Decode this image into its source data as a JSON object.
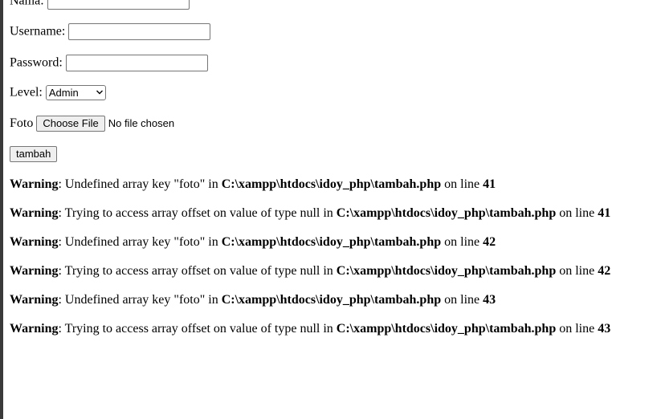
{
  "form": {
    "nama_label": "Nama:",
    "username_label": "Username:",
    "password_label": "Password:",
    "level_label": "Level:",
    "level_selected": "Admin",
    "foto_label": "Foto",
    "choose_file_label": "Choose File",
    "no_file_text": "No file chosen",
    "submit_label": "tambah"
  },
  "warnings": [
    {
      "label": "Warning",
      "msg": ": Undefined array key \"foto\" in ",
      "path": "C:\\xampp\\htdocs\\idoy_php\\tambah.php",
      "on": " on line ",
      "line": "41"
    },
    {
      "label": "Warning",
      "msg": ": Trying to access array offset on value of type null in ",
      "path": "C:\\xampp\\htdocs\\idoy_php\\tambah.php",
      "on": " on line ",
      "line": "41"
    },
    {
      "label": "Warning",
      "msg": ": Undefined array key \"foto\" in ",
      "path": "C:\\xampp\\htdocs\\idoy_php\\tambah.php",
      "on": " on line ",
      "line": "42"
    },
    {
      "label": "Warning",
      "msg": ": Trying to access array offset on value of type null in ",
      "path": "C:\\xampp\\htdocs\\idoy_php\\tambah.php",
      "on": " on line ",
      "line": "42"
    },
    {
      "label": "Warning",
      "msg": ": Undefined array key \"foto\" in ",
      "path": "C:\\xampp\\htdocs\\idoy_php\\tambah.php",
      "on": " on line ",
      "line": "43"
    },
    {
      "label": "Warning",
      "msg": ": Trying to access array offset on value of type null in ",
      "path": "C:\\xampp\\htdocs\\idoy_php\\tambah.php",
      "on": " on line ",
      "line": "43"
    }
  ]
}
